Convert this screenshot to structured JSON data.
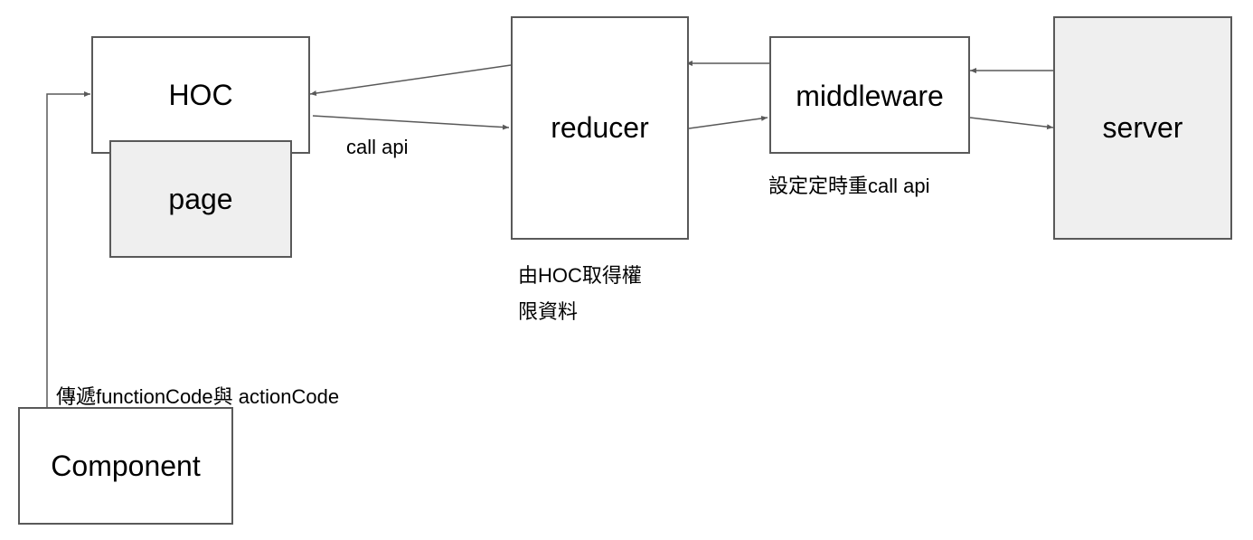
{
  "nodes": {
    "hoc": "HOC",
    "page": "page",
    "reducer": "reducer",
    "middleware": "middleware",
    "server": "server",
    "component": "Component"
  },
  "labels": {
    "call_api": "call api",
    "timer_call_api": "設定定時重call api",
    "reducer_note": "由HOC取得權\n限資料",
    "pass_codes": "傳遞functionCode與 actionCode"
  },
  "colors": {
    "border": "#595959",
    "gray_fill": "#efefef",
    "arrow": "#595959"
  }
}
